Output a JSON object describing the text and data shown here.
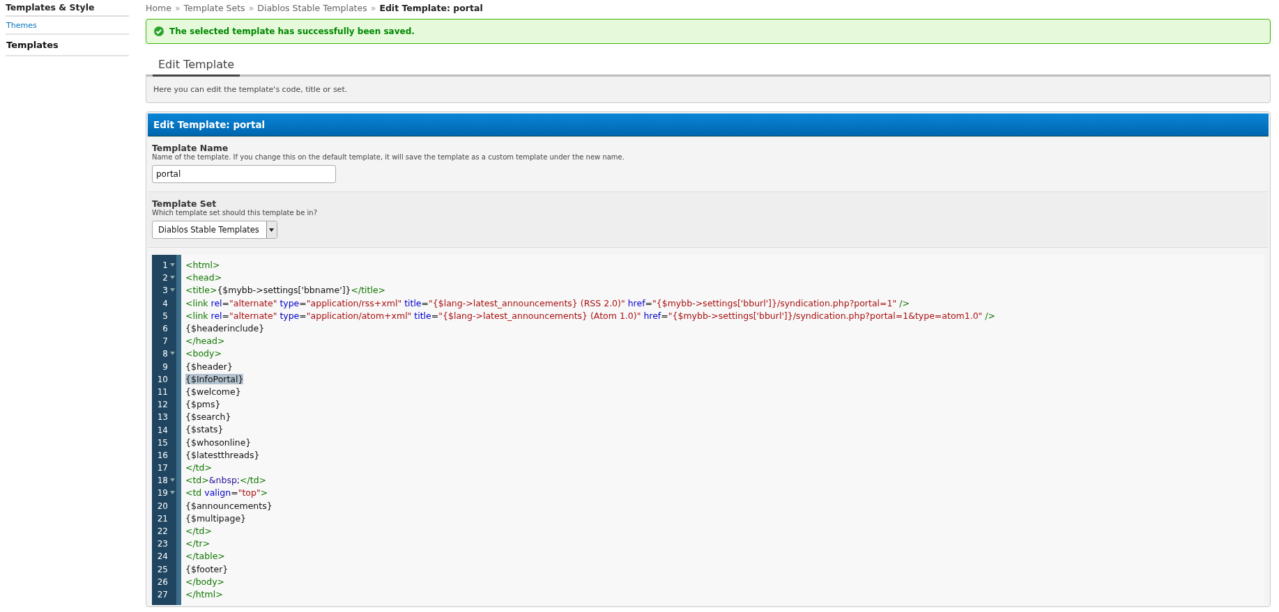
{
  "sidebar": {
    "title": "Templates & Style",
    "items": [
      {
        "label": "Themes",
        "selected": false
      },
      {
        "label": "Templates",
        "selected": true
      }
    ]
  },
  "breadcrumb": {
    "links": [
      "Home",
      "Template Sets",
      "Diablos Stable Templates"
    ],
    "separator": "»",
    "current": "Edit Template: portal"
  },
  "alert": {
    "kind": "success",
    "message": "The selected template has successfully been saved."
  },
  "tabs": [
    {
      "label": "Edit Template",
      "selected": true
    }
  ],
  "tab_description": "Here you can edit the template's code, title or set.",
  "panel": {
    "title": "Edit Template: portal",
    "fields": [
      {
        "kind": "text",
        "label": "Template Name",
        "description": "Name of the template. If you change this on the default template, it will save the template as a custom template under the new name.",
        "value": "portal"
      },
      {
        "kind": "select",
        "label": "Template Set",
        "description": "Which template set should this template be in?",
        "value": "Diablos Stable Templates"
      }
    ],
    "code": {
      "lines": [
        {
          "number": "1",
          "foldable": true,
          "selected": false,
          "tokens": [
            {
              "kind": "tag",
              "text": "<html>"
            }
          ]
        },
        {
          "number": "2",
          "foldable": true,
          "selected": false,
          "tokens": [
            {
              "kind": "tag",
              "text": "<head>"
            }
          ]
        },
        {
          "number": "3",
          "foldable": true,
          "selected": false,
          "tokens": [
            {
              "kind": "tag",
              "text": "<title>"
            },
            {
              "kind": "text",
              "text": "{$mybb->settings['bbname']}"
            },
            {
              "kind": "tag",
              "text": "</title>"
            }
          ]
        },
        {
          "number": "4",
          "foldable": false,
          "selected": false,
          "tokens": [
            {
              "kind": "tag",
              "text": "<link "
            },
            {
              "kind": "attr",
              "text": "rel"
            },
            {
              "kind": "text",
              "text": "="
            },
            {
              "kind": "string",
              "text": "\"alternate\" "
            },
            {
              "kind": "attr",
              "text": "type"
            },
            {
              "kind": "text",
              "text": "="
            },
            {
              "kind": "string",
              "text": "\"application/rss+xml\" "
            },
            {
              "kind": "attr",
              "text": "title"
            },
            {
              "kind": "text",
              "text": "="
            },
            {
              "kind": "string",
              "text": "\"{$lang->latest_announcements} (RSS 2.0)\" "
            },
            {
              "kind": "attr",
              "text": "href"
            },
            {
              "kind": "text",
              "text": "="
            },
            {
              "kind": "string",
              "text": "\"{$mybb->settings['bburl']}/syndication.php?portal=1\""
            },
            {
              "kind": "tag",
              "text": " />"
            }
          ]
        },
        {
          "number": "5",
          "foldable": false,
          "selected": false,
          "tokens": [
            {
              "kind": "tag",
              "text": "<link "
            },
            {
              "kind": "attr",
              "text": "rel"
            },
            {
              "kind": "text",
              "text": "="
            },
            {
              "kind": "string",
              "text": "\"alternate\" "
            },
            {
              "kind": "attr",
              "text": "type"
            },
            {
              "kind": "text",
              "text": "="
            },
            {
              "kind": "string",
              "text": "\"application/atom+xml\" "
            },
            {
              "kind": "attr",
              "text": "title"
            },
            {
              "kind": "text",
              "text": "="
            },
            {
              "kind": "string",
              "text": "\"{$lang->latest_announcements} (Atom 1.0)\" "
            },
            {
              "kind": "attr",
              "text": "href"
            },
            {
              "kind": "text",
              "text": "="
            },
            {
              "kind": "string",
              "text": "\"{$mybb->settings['bburl']}/syndication.php?portal=1&type=atom1.0\""
            },
            {
              "kind": "tag",
              "text": " />"
            }
          ]
        },
        {
          "number": "6",
          "foldable": false,
          "selected": false,
          "tokens": [
            {
              "kind": "text",
              "text": "{$headerinclude}"
            }
          ]
        },
        {
          "number": "7",
          "foldable": false,
          "selected": false,
          "tokens": [
            {
              "kind": "tag",
              "text": "</head>"
            }
          ]
        },
        {
          "number": "8",
          "foldable": true,
          "selected": false,
          "tokens": [
            {
              "kind": "tag",
              "text": "<body>"
            }
          ]
        },
        {
          "number": "9",
          "foldable": false,
          "selected": false,
          "tokens": [
            {
              "kind": "text",
              "text": "{$header}"
            }
          ]
        },
        {
          "number": "10",
          "foldable": false,
          "selected": true,
          "tokens": [
            {
              "kind": "text",
              "text": "{$InfoPortal}"
            }
          ]
        },
        {
          "number": "11",
          "foldable": false,
          "selected": false,
          "tokens": [
            {
              "kind": "text",
              "text": "{$welcome}"
            }
          ]
        },
        {
          "number": "12",
          "foldable": false,
          "selected": false,
          "tokens": [
            {
              "kind": "text",
              "text": "{$pms}"
            }
          ]
        },
        {
          "number": "13",
          "foldable": false,
          "selected": false,
          "tokens": [
            {
              "kind": "text",
              "text": "{$search}"
            }
          ]
        },
        {
          "number": "14",
          "foldable": false,
          "selected": false,
          "tokens": [
            {
              "kind": "text",
              "text": "{$stats}"
            }
          ]
        },
        {
          "number": "15",
          "foldable": false,
          "selected": false,
          "tokens": [
            {
              "kind": "text",
              "text": "{$whosonline}"
            }
          ]
        },
        {
          "number": "16",
          "foldable": false,
          "selected": false,
          "tokens": [
            {
              "kind": "text",
              "text": "{$latestthreads}"
            }
          ]
        },
        {
          "number": "17",
          "foldable": false,
          "selected": false,
          "tokens": [
            {
              "kind": "tag",
              "text": "</td>"
            }
          ]
        },
        {
          "number": "18",
          "foldable": true,
          "selected": false,
          "tokens": [
            {
              "kind": "tag",
              "text": "<td>"
            },
            {
              "kind": "entity",
              "text": "&nbsp;"
            },
            {
              "kind": "tag",
              "text": "</td>"
            }
          ]
        },
        {
          "number": "19",
          "foldable": true,
          "selected": false,
          "tokens": [
            {
              "kind": "tag",
              "text": "<td "
            },
            {
              "kind": "attr",
              "text": "valign"
            },
            {
              "kind": "text",
              "text": "="
            },
            {
              "kind": "string",
              "text": "\"top\""
            },
            {
              "kind": "tag",
              "text": ">"
            }
          ]
        },
        {
          "number": "20",
          "foldable": false,
          "selected": false,
          "tokens": [
            {
              "kind": "text",
              "text": "{$announcements}"
            }
          ]
        },
        {
          "number": "21",
          "foldable": false,
          "selected": false,
          "tokens": [
            {
              "kind": "text",
              "text": "{$multipage}"
            }
          ]
        },
        {
          "number": "22",
          "foldable": false,
          "selected": false,
          "tokens": [
            {
              "kind": "tag",
              "text": "</td>"
            }
          ]
        },
        {
          "number": "23",
          "foldable": false,
          "selected": false,
          "tokens": [
            {
              "kind": "tag",
              "text": "</tr>"
            }
          ]
        },
        {
          "number": "24",
          "foldable": false,
          "selected": false,
          "tokens": [
            {
              "kind": "tag",
              "text": "</table>"
            }
          ]
        },
        {
          "number": "25",
          "foldable": false,
          "selected": false,
          "tokens": [
            {
              "kind": "text",
              "text": "{$footer}"
            }
          ]
        },
        {
          "number": "26",
          "foldable": false,
          "selected": false,
          "tokens": [
            {
              "kind": "tag",
              "text": "</body>"
            }
          ]
        },
        {
          "number": "27",
          "foldable": false,
          "selected": false,
          "tokens": [
            {
              "kind": "tag",
              "text": "</html>"
            }
          ]
        }
      ]
    }
  }
}
